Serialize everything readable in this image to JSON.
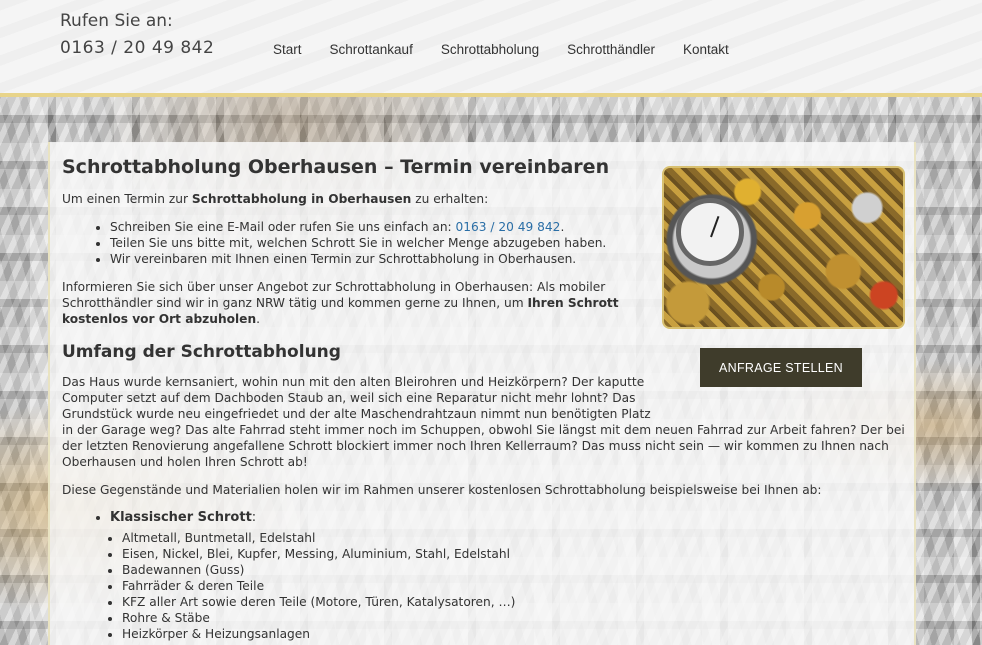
{
  "header": {
    "phone_label": "Rufen Sie an:",
    "phone_number": "0163 / 20 49 842",
    "nav": [
      "Start",
      "Schrottankauf",
      "Schrottabholung",
      "Schrotthändler",
      "Kontakt"
    ]
  },
  "main": {
    "title": "Schrottabholung Oberhausen – Termin vereinbaren",
    "intro_pre": "Um einen Termin zur ",
    "intro_bold": "Schrottabholung in Oberhausen",
    "intro_post": " zu erhalten:",
    "steps": {
      "email_pre": "Schreiben Sie eine E-Mail oder rufen Sie uns einfach an: ",
      "email_phone": "0163 / 20 49 842",
      "email_post": ".",
      "tell": "Teilen Sie uns bitte mit, welchen Schrott Sie in welcher Menge abzugeben haben.",
      "agree": "Wir vereinbaren mit Ihnen einen Termin zur Schrottabholung in Oberhausen."
    },
    "info_line1": "Informieren Sie sich über unser Angebot zur Schrottabholung in Oberhausen: Als mobiler",
    "info_line2_pre": "Schrotthändler sind wir in ganz NRW tätig und kommen gerne zu Ihnen, um ",
    "info_line2_bold": "Ihren Schrott",
    "info_line3_bold": "kostenlos vor Ort abzuholen",
    "info_line3_post": ".",
    "section_title": "Umfang der Schrottabholung",
    "scope_lines": [
      "Das Haus wurde kernsaniert, wohin nun mit den alten Bleirohren und Heizkörpern? Der kaputte",
      "Computer setzt auf dem Dachboden Staub an, weil sich eine Reparatur nicht mehr lohnt? Das",
      "Grundstück wurde neu eingefriedet und der alte Maschendrahtzaun nimmt nun benötigten Platz",
      "in der Garage weg? Das alte Fahrrad steht immer noch im Schuppen, obwohl Sie längst mit dem neuen Fahrrad zur Arbeit fahren? Der bei",
      "der letzten Renovierung angefallene Schrott blockiert immer noch Ihren Kellerraum? Das muss nicht sein — wir kommen zu Ihnen nach",
      "Oberhausen und holen Ihren Schrott ab!"
    ],
    "materials_intro": "Diese Gegenstände und Materialien holen wir im Rahmen unserer kostenlosen Schrottabholung beispielsweise bei Ihnen ab:",
    "category_label": "Klassischer Schrott",
    "category_colon": ":",
    "items": [
      "Altmetall, Buntmetall, Edelstahl",
      "Eisen, Nickel, Blei, Kupfer, Messing, Aluminium, Stahl, Edelstahl",
      "Badewannen (Guss)",
      "Fahrräder & deren Teile",
      "KFZ aller Art sowie deren Teile (Motore, Türen, Katalysatoren, …)",
      "Rohre & Stäbe",
      "Heizkörper & Heizungsanlagen"
    ],
    "cta_label": "ANFRAGE STELLEN"
  }
}
